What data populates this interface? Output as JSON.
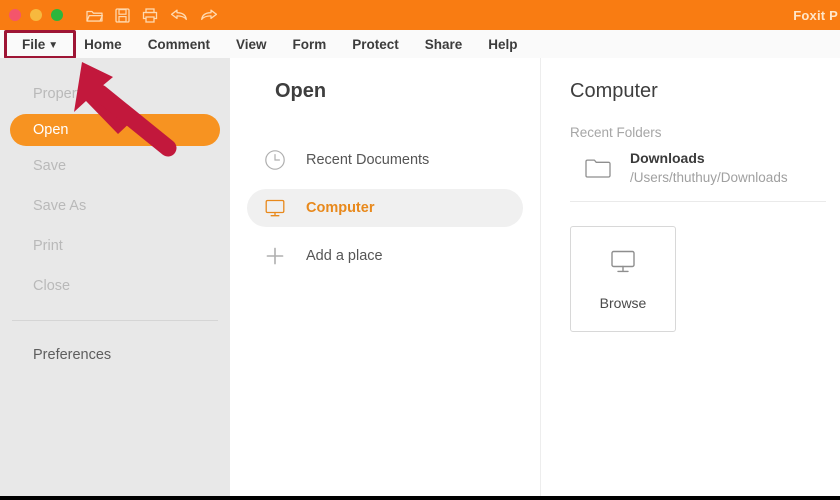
{
  "window": {
    "app_title": "Foxit P",
    "accent_orange": "#F97C12",
    "highlight_red": "#9E1535",
    "traffic_lights": [
      "close-red",
      "minimize-yellow",
      "maximize-green"
    ],
    "toolbar_icons": [
      "open-folder-icon",
      "save-icon",
      "print-icon",
      "undo-icon",
      "redo-icon"
    ]
  },
  "menubar": {
    "items": [
      {
        "label": "File",
        "has_chevron": true,
        "highlighted": true
      },
      {
        "label": "Home",
        "has_chevron": false,
        "highlighted": false
      },
      {
        "label": "Comment",
        "has_chevron": false,
        "highlighted": false
      },
      {
        "label": "View",
        "has_chevron": false,
        "highlighted": false
      },
      {
        "label": "Form",
        "has_chevron": false,
        "highlighted": false
      },
      {
        "label": "Protect",
        "has_chevron": false,
        "highlighted": false
      },
      {
        "label": "Share",
        "has_chevron": false,
        "highlighted": false
      },
      {
        "label": "Help",
        "has_chevron": false,
        "highlighted": false
      }
    ]
  },
  "sidebar": {
    "items": [
      {
        "label": "Properties",
        "state": "dim"
      },
      {
        "label": "Open",
        "state": "active"
      },
      {
        "label": "Save",
        "state": "dim"
      },
      {
        "label": "Save As",
        "state": "dim"
      },
      {
        "label": "Print",
        "state": "dim"
      },
      {
        "label": "Close",
        "state": "dim"
      }
    ],
    "preferences": "Preferences"
  },
  "open_panel": {
    "title": "Open",
    "rows": [
      {
        "label": "Recent Documents",
        "icon": "clock-icon",
        "selected": false
      },
      {
        "label": "Computer",
        "icon": "monitor-icon",
        "selected": true
      },
      {
        "label": "Add a place",
        "icon": "plus-icon",
        "selected": false
      }
    ]
  },
  "computer_panel": {
    "title": "Computer",
    "recent_folders_label": "Recent Folders",
    "folder": {
      "name": "Downloads",
      "path": "/Users/thuthuy/Downloads",
      "icon": "folder-icon"
    },
    "browse": {
      "label": "Browse",
      "icon": "monitor-icon"
    }
  },
  "annotation": {
    "arrow_color": "#C2183C",
    "points_to": "File"
  }
}
